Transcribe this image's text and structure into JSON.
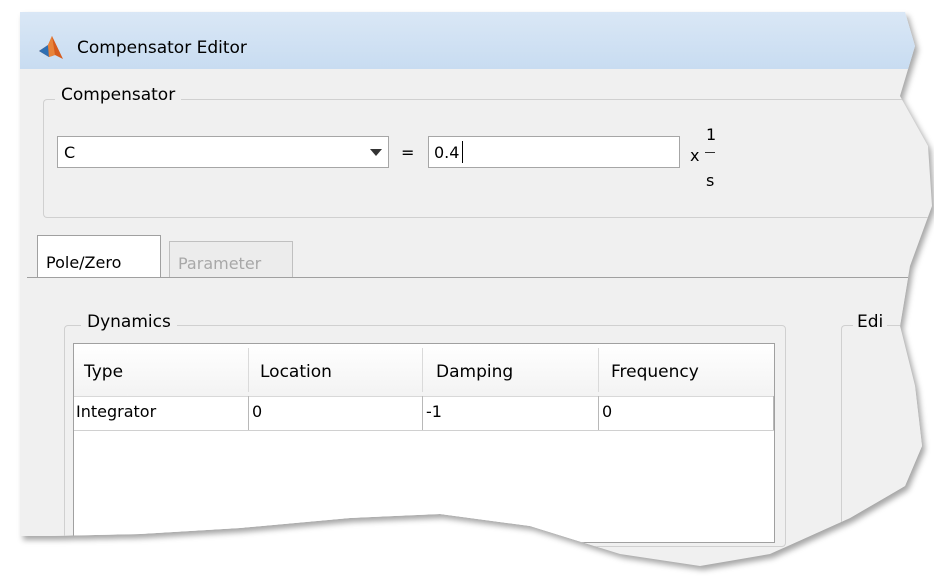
{
  "window": {
    "title": "Compensator Editor"
  },
  "compensator": {
    "group_label": "Compensator",
    "selected": "C",
    "equals": "=",
    "gain_value": "0.4",
    "times": "x",
    "fraction_numerator": "1",
    "fraction_denominator": "s"
  },
  "tabs": [
    {
      "label": "Pole/Zero",
      "active": true,
      "enabled": true
    },
    {
      "label": "Parameter",
      "active": false,
      "enabled": false
    }
  ],
  "dynamics": {
    "group_label": "Dynamics",
    "columns": [
      "Type",
      "Location",
      "Damping",
      "Frequency"
    ],
    "rows": [
      [
        "Integrator",
        "0",
        "-1",
        "0"
      ]
    ]
  },
  "edit_group": {
    "label": "Edi"
  }
}
